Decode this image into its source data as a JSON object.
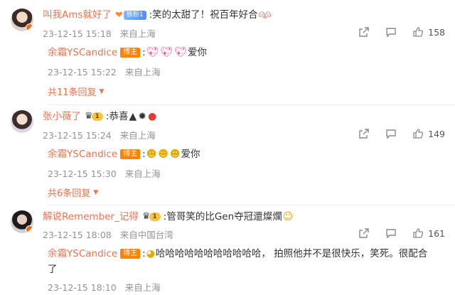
{
  "comments": [
    {
      "username": "叫我Ams就好了",
      "fan_badge": "铁粉1",
      "text": ":笑的太甜了！祝百年好合",
      "time": "23-12-15 15:18",
      "location": "来自上海",
      "likes": "158",
      "reply": {
        "username": "余霜YSCandice",
        "owner_badge": "博主",
        "colon": ":",
        "text": "爱你",
        "time": "23-12-15 15:22",
        "location": "来自上海"
      },
      "more_replies": "共11条回复"
    },
    {
      "username": "张小薇了",
      "vip_level": "1",
      "text": ":恭喜",
      "time": "23-12-15 15:24",
      "location": "来自上海",
      "likes": "149",
      "reply": {
        "username": "余霜YSCandice",
        "owner_badge": "博主",
        "colon": ":",
        "text": "爱你",
        "time": "23-12-15 15:30",
        "location": "来自上海"
      },
      "more_replies": "共6条回复"
    },
    {
      "username": "解说Remember_记得",
      "vip_level": "1",
      "text": ":管哥笑的比Gen夺冠還燦爛",
      "time": "23-12-15 18:08",
      "location": "来自中国台湾",
      "likes": "161",
      "reply": {
        "username": "余霜YSCandice",
        "owner_badge": "博主",
        "colon": ":",
        "text": "哈哈哈哈哈哈哈哈哈哈哈， 拍照他并不是很快乐，笑死。很配合",
        "text_cont": "了",
        "time": "23-12-15 18:10",
        "location": "来自上海"
      }
    }
  ],
  "icons": {
    "share": "share-icon",
    "comment": "comment-icon",
    "like": "thumbs-up-icon",
    "more_caret": "caret-down-icon"
  },
  "colors": {
    "username": "#eb7350",
    "meta": "#939393",
    "owner_badge": "#ff8200"
  }
}
